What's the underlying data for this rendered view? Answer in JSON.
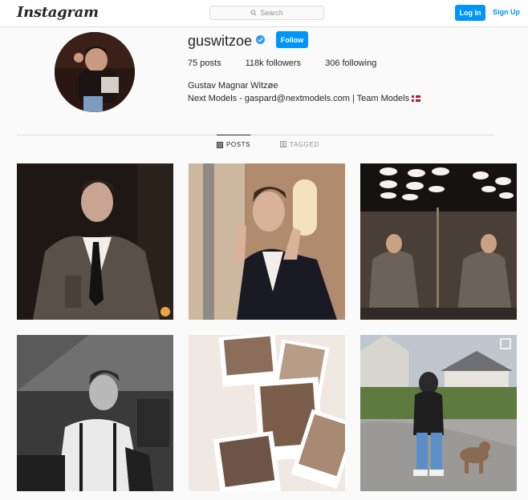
{
  "header": {
    "logo": "Instagram",
    "search_placeholder": "Search",
    "login_label": "Log In",
    "signup_label": "Sign Up"
  },
  "profile": {
    "username": "guswitzoe",
    "verified": true,
    "follow_label": "Follow",
    "stats": [
      {
        "label": "75 posts"
      },
      {
        "label": "118k followers"
      },
      {
        "label": "306 following"
      }
    ],
    "full_name": "Gustav Magnar Witzøe",
    "bio": "Next Models - gaspard@nextmodels.com | Team Models"
  },
  "tabs": [
    {
      "label": "POSTS",
      "active": true,
      "icon": "grid-icon"
    },
    {
      "label": "TAGGED",
      "active": false,
      "icon": "tag-icon"
    }
  ],
  "posts": [
    {
      "name": "post-suit-tie"
    },
    {
      "name": "post-rock-hands"
    },
    {
      "name": "post-elevator-mirror"
    },
    {
      "name": "post-bw-suspenders"
    },
    {
      "name": "post-polaroids"
    },
    {
      "name": "post-walking-dog"
    }
  ],
  "colors": {
    "accent": "#0095f6",
    "text": "#262626",
    "muted": "#8e8e8e",
    "border": "#dbdbdb"
  }
}
